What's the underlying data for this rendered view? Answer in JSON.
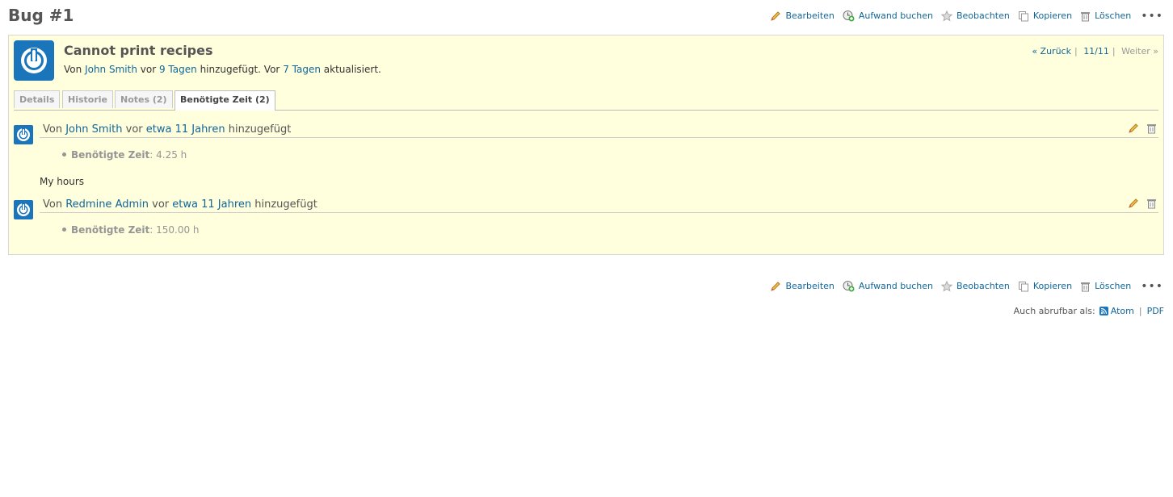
{
  "page": {
    "title": "Bug #1"
  },
  "actions": {
    "edit": "Bearbeiten",
    "log_time": "Aufwand buchen",
    "watch": "Beobachten",
    "copy": "Kopieren",
    "delete": "Löschen",
    "more": "•••"
  },
  "issue": {
    "subject": "Cannot print recipes",
    "author_prefix": "Von",
    "author": "John Smith",
    "created_prefix": "vor",
    "created_ago": "9 Tagen",
    "created_suffix": "hinzugefügt. Vor",
    "updated_ago": "7 Tagen",
    "updated_suffix": "aktualisiert.",
    "nav": {
      "prev": "« Zurück",
      "position": "11/11",
      "next": "Weiter »",
      "sep": "|"
    }
  },
  "tabs": [
    {
      "label": "Details"
    },
    {
      "label": "Historie"
    },
    {
      "label": "Notes (2)"
    },
    {
      "label": "Benötigte Zeit (2)",
      "selected": true
    }
  ],
  "journals": [
    {
      "prefix": "Von",
      "author": "John Smith",
      "mid": "vor",
      "ago": "etwa 11 Jahren",
      "suffix": "hinzugefügt",
      "detail_label": "Benötigte Zeit",
      "detail_value": ": 4.25 h",
      "note": "My hours"
    },
    {
      "prefix": "Von",
      "author": "Redmine Admin",
      "mid": "vor",
      "ago": "etwa 11 Jahren",
      "suffix": "hinzugefügt",
      "detail_label": "Benötigte Zeit",
      "detail_value": ": 150.00 h"
    }
  ],
  "other_formats": {
    "label": "Auch abrufbar als:",
    "atom": "Atom",
    "sep": "|",
    "pdf": "PDF"
  },
  "icons": {
    "edit": "pencil-icon",
    "log_time": "clock-add-icon",
    "watch": "star-icon",
    "copy": "copy-icon",
    "delete": "trash-icon",
    "feed": "rss-feed-icon",
    "avatar": "power-avatar-icon"
  },
  "colors": {
    "link": "#116699",
    "issue_bg": "#ffffdd",
    "avatar_blue": "#1a75bb"
  }
}
